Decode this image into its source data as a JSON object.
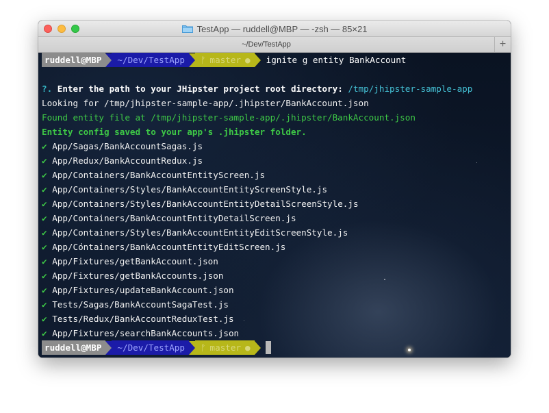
{
  "window": {
    "title": "TestApp — ruddell@MBP — -zsh — 85×21",
    "tab_title": "~/Dev/TestApp",
    "new_tab": "+"
  },
  "prompt": {
    "user": "ruddell@MBP",
    "dir": "~/Dev/TestApp",
    "branch_icon": "ᚠ",
    "branch": "master",
    "dirty": "●"
  },
  "command": "ignite g entity BankAccount",
  "question": {
    "mark": "?.",
    "text": "Enter the path to your JHipster project root directory:",
    "answer": "/tmp/jhipster-sample-app"
  },
  "messages": {
    "looking": "Looking for /tmp/jhipster-sample-app/.jhipster/BankAccount.json",
    "found": "Found entity file at /tmp/jhipster-sample-app/.jhipster/BankAccount.json",
    "saved": "Entity config saved to your app's .jhipster folder."
  },
  "check_mark": "✔",
  "files": [
    "App/Sagas/BankAccountSagas.js",
    "App/Redux/BankAccountRedux.js",
    "App/Containers/BankAccountEntityScreen.js",
    "App/Containers/Styles/BankAccountEntityScreenStyle.js",
    "App/Containers/Styles/BankAccountEntityDetailScreenStyle.js",
    "App/Containers/BankAccountEntityDetailScreen.js",
    "App/Containers/Styles/BankAccountEntityEditScreenStyle.js",
    "App/Containers/BankAccountEntityEditScreen.js",
    "App/Fixtures/getBankAccount.json",
    "App/Fixtures/getBankAccounts.json",
    "App/Fixtures/updateBankAccount.json",
    "Tests/Sagas/BankAccountSagaTest.js",
    "Tests/Redux/BankAccountReduxTest.js",
    "App/Fixtures/searchBankAccounts.json"
  ]
}
